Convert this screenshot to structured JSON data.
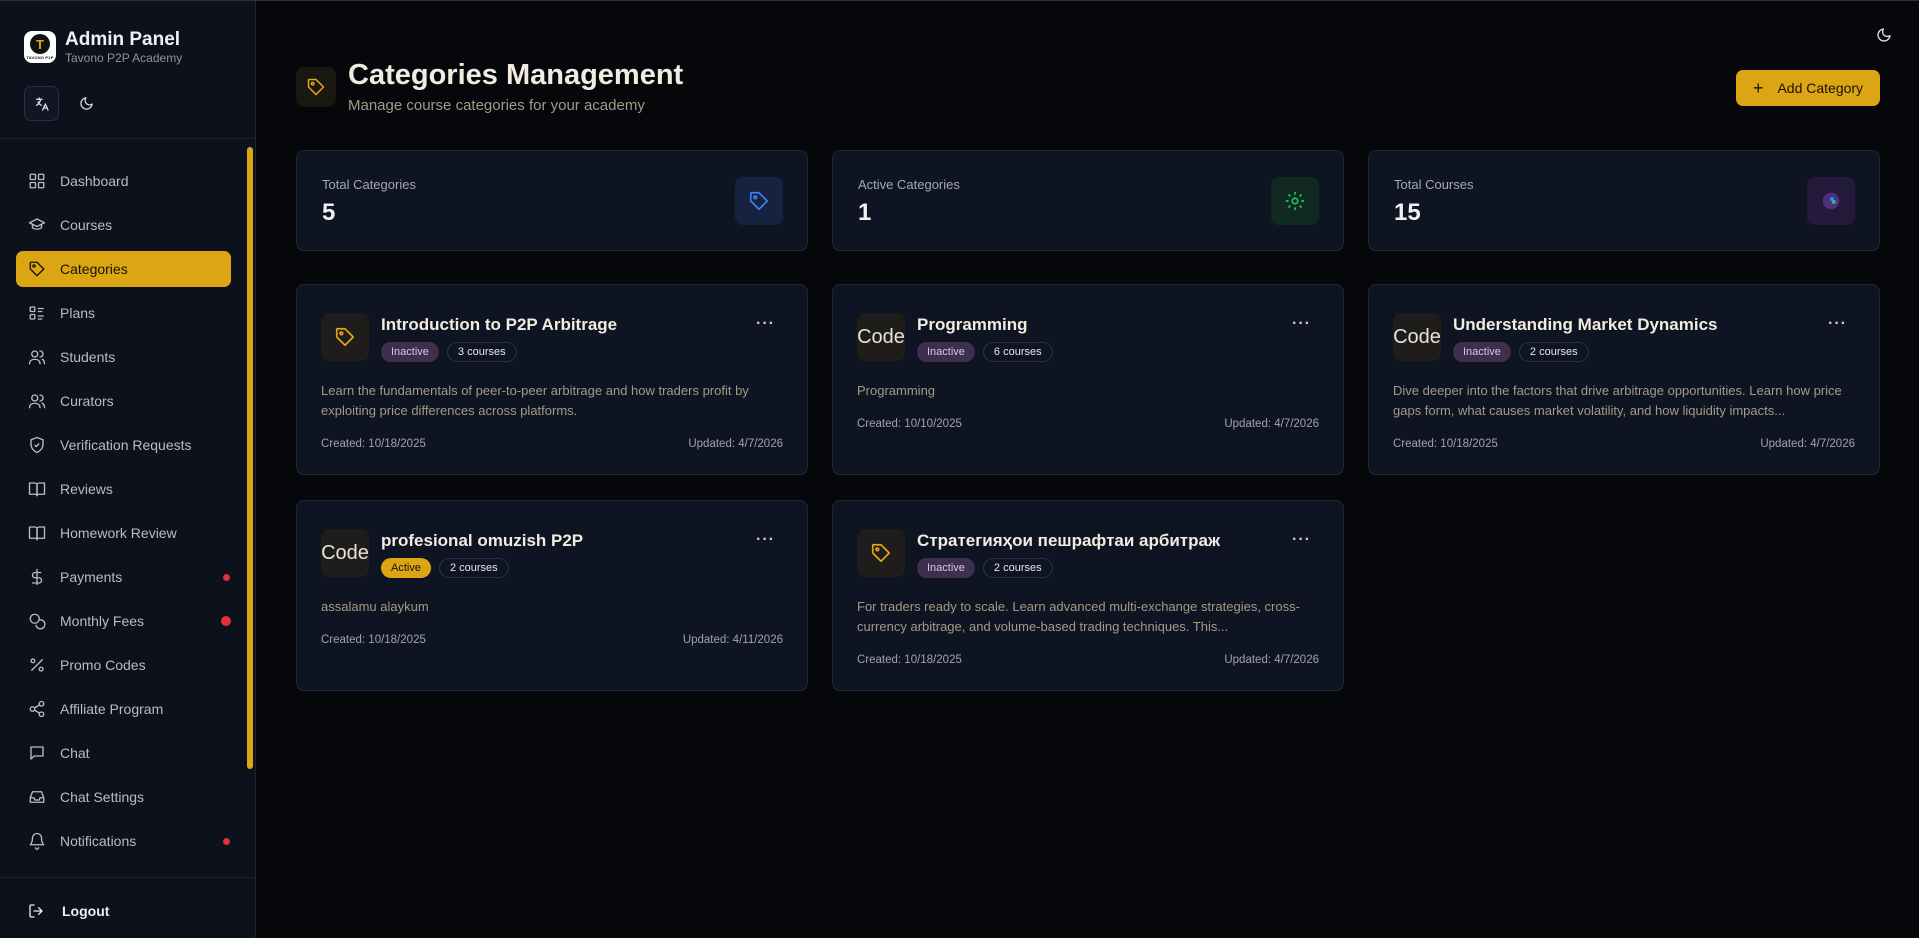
{
  "brand": {
    "title": "Admin Panel",
    "subtitle": "Tavono P2P Academy",
    "logo_letter": "T",
    "logo_text": "TAVONO P2P"
  },
  "sidebar": {
    "items": [
      {
        "label": "Dashboard",
        "icon": "dashboard-icon",
        "active": false
      },
      {
        "label": "Courses",
        "icon": "graduation-cap-icon",
        "active": false
      },
      {
        "label": "Categories",
        "icon": "tag-icon",
        "active": true
      },
      {
        "label": "Plans",
        "icon": "list-icon",
        "active": false
      },
      {
        "label": "Students",
        "icon": "users-icon",
        "active": false
      },
      {
        "label": "Curators",
        "icon": "users-icon",
        "active": false
      },
      {
        "label": "Verification Requests",
        "icon": "shield-check-icon",
        "active": false
      },
      {
        "label": "Reviews",
        "icon": "book-open-icon",
        "active": false
      },
      {
        "label": "Homework Review",
        "icon": "book-open-icon",
        "active": false
      },
      {
        "label": "Payments",
        "icon": "dollar-icon",
        "active": false,
        "dot": true
      },
      {
        "label": "Monthly Fees",
        "icon": "coins-icon",
        "active": false,
        "dot": true
      },
      {
        "label": "Promo Codes",
        "icon": "percent-icon",
        "active": false
      },
      {
        "label": "Affiliate Program",
        "icon": "share-icon",
        "active": false
      },
      {
        "label": "Chat",
        "icon": "chat-icon",
        "active": false
      },
      {
        "label": "Chat Settings",
        "icon": "inbox-icon",
        "active": false
      },
      {
        "label": "Notifications",
        "icon": "bell-icon",
        "active": false,
        "dot": true
      }
    ],
    "logout_label": "Logout"
  },
  "header": {
    "title": "Categories Management",
    "subtitle": "Manage course categories for your academy",
    "add_button_label": "Add Category"
  },
  "stats": [
    {
      "label": "Total Categories",
      "value": "5",
      "icon": "tag-icon",
      "color": "#3b82f6"
    },
    {
      "label": "Active Categories",
      "value": "1",
      "icon": "gear-icon",
      "color": "#22c55e"
    },
    {
      "label": "Total Courses",
      "value": "15",
      "icon": "course-icon",
      "color": "#8b5cf6"
    }
  ],
  "categories": [
    {
      "title": "Introduction to P2P Arbitrage",
      "icon_type": "tag",
      "status": "Inactive",
      "courses": "3 courses",
      "description": "Learn the fundamentals of peer-to-peer arbitrage and how traders profit by exploiting price differences across platforms.",
      "created": "Created: 10/18/2025",
      "updated": "Updated: 4/7/2026"
    },
    {
      "title": "Programming",
      "icon_type": "code",
      "icon_text": "Code",
      "status": "Inactive",
      "courses": "6 courses",
      "description": "Programming",
      "created": "Created: 10/10/2025",
      "updated": "Updated: 4/7/2026"
    },
    {
      "title": "Understanding Market Dynamics",
      "icon_type": "code",
      "icon_text": "Code",
      "status": "Inactive",
      "courses": "2 courses",
      "description": "Dive deeper into the factors that drive arbitrage opportunities. Learn how price gaps form, what causes market volatility, and how liquidity impacts...",
      "created": "Created: 10/18/2025",
      "updated": "Updated: 4/7/2026"
    },
    {
      "title": "profesional omuzish P2P",
      "icon_type": "code",
      "icon_text": "Code",
      "status": "Active",
      "courses": "2 courses",
      "description": "assalamu alaykum",
      "created": "Created: 10/18/2025",
      "updated": "Updated: 4/11/2026"
    },
    {
      "title": "Стратегияҳои пешрафтаи арбитраж",
      "icon_type": "tag",
      "status": "Inactive",
      "courses": "2 courses",
      "description": "For traders ready to scale. Learn advanced multi-exchange strategies, cross-currency arbitrage, and volume-based trading techniques. This...",
      "created": "Created: 10/18/2025",
      "updated": "Updated: 4/7/2026"
    }
  ],
  "colors": {
    "accent": "#dca513",
    "background": "#05070b",
    "card": "#0f1422",
    "inactive_badge": "#3d2f4d"
  }
}
